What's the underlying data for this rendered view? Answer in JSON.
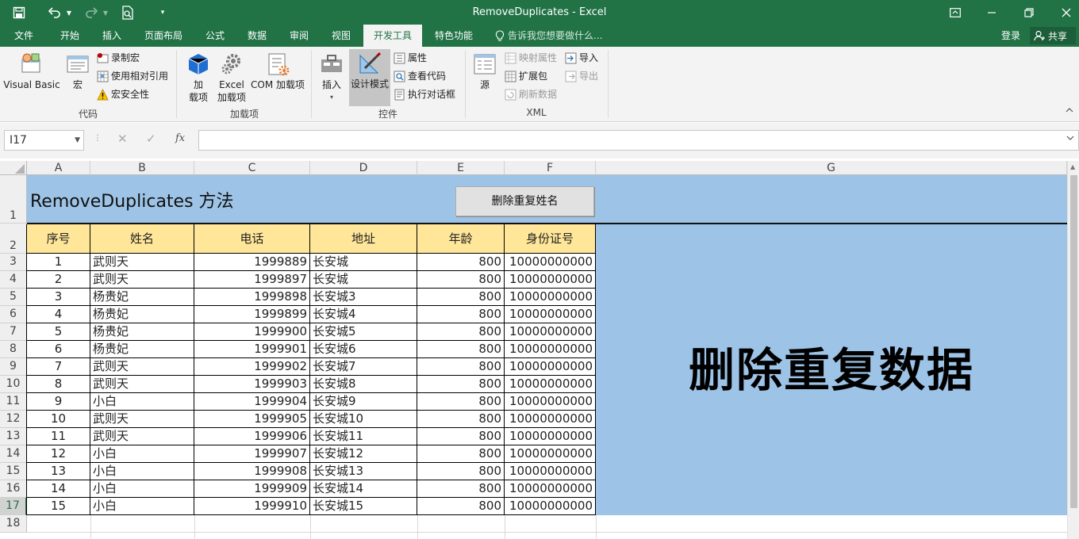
{
  "window": {
    "title": "RemoveDuplicates  -  Excel"
  },
  "tabs": [
    {
      "label": "文件"
    },
    {
      "label": "开始"
    },
    {
      "label": "插入"
    },
    {
      "label": "页面布局"
    },
    {
      "label": "公式"
    },
    {
      "label": "数据"
    },
    {
      "label": "审阅"
    },
    {
      "label": "视图"
    },
    {
      "label": "开发工具"
    },
    {
      "label": "特色功能"
    }
  ],
  "tell_me": "告诉我您想要做什么...",
  "login": "登录",
  "share": "共享",
  "ribbon": {
    "code": {
      "label": "代码",
      "visual_basic": "Visual Basic",
      "macro": "宏",
      "record": "录制宏",
      "relative": "使用相对引用",
      "security": "宏安全性"
    },
    "addins": {
      "label": "加载项",
      "addin_l1": "加",
      "addin_l2": "载项",
      "excel_l1": "Excel",
      "excel_l2": "加载项",
      "com": "COM 加载项"
    },
    "controls": {
      "label": "控件",
      "insert": "插入",
      "design": "设计模式",
      "properties": "属性",
      "view_code": "查看代码",
      "run_dialog": "执行对话框"
    },
    "xml": {
      "label": "XML",
      "source": "源",
      "map_props": "映射属性",
      "expansion": "扩展包",
      "refresh": "刷新数据",
      "import": "导入",
      "export": "导出"
    }
  },
  "formula_bar": {
    "name_box": "I17",
    "fx": "fx",
    "value": ""
  },
  "columns": [
    "A",
    "B",
    "C",
    "D",
    "E",
    "F",
    "G"
  ],
  "rows": [
    "1",
    "2",
    "3",
    "4",
    "5",
    "6",
    "7",
    "8",
    "9",
    "10",
    "11",
    "12",
    "13",
    "14",
    "15",
    "16",
    "17",
    "18"
  ],
  "sheet": {
    "title": "RemoveDuplicates 方法",
    "button": "删除重复姓名",
    "big_text": "删除重复数据",
    "headers": [
      "序号",
      "姓名",
      "电话",
      "地址",
      "年龄",
      "身份证号"
    ],
    "data": [
      [
        "1",
        "武则天",
        "1999889",
        "长安城",
        "800",
        "10000000000"
      ],
      [
        "2",
        "武则天",
        "1999897",
        "长安城",
        "800",
        "10000000000"
      ],
      [
        "3",
        "杨贵妃",
        "1999898",
        "长安城3",
        "800",
        "10000000000"
      ],
      [
        "4",
        "杨贵妃",
        "1999899",
        "长安城4",
        "800",
        "10000000000"
      ],
      [
        "5",
        "杨贵妃",
        "1999900",
        "长安城5",
        "800",
        "10000000000"
      ],
      [
        "6",
        "杨贵妃",
        "1999901",
        "长安城6",
        "800",
        "10000000000"
      ],
      [
        "7",
        "武则天",
        "1999902",
        "长安城7",
        "800",
        "10000000000"
      ],
      [
        "8",
        "武则天",
        "1999903",
        "长安城8",
        "800",
        "10000000000"
      ],
      [
        "9",
        "小白",
        "1999904",
        "长安城9",
        "800",
        "10000000000"
      ],
      [
        "10",
        "武则天",
        "1999905",
        "长安城10",
        "800",
        "10000000000"
      ],
      [
        "11",
        "武则天",
        "1999906",
        "长安城11",
        "800",
        "10000000000"
      ],
      [
        "12",
        "小白",
        "1999907",
        "长安城12",
        "800",
        "10000000000"
      ],
      [
        "13",
        "小白",
        "1999908",
        "长安城13",
        "800",
        "10000000000"
      ],
      [
        "14",
        "小白",
        "1999909",
        "长安城14",
        "800",
        "10000000000"
      ],
      [
        "15",
        "小白",
        "1999910",
        "长安城15",
        "800",
        "10000000000"
      ]
    ]
  },
  "colors": {
    "brand": "#217346",
    "header_fill": "#ffe699",
    "band_fill": "#9dc3e6"
  }
}
